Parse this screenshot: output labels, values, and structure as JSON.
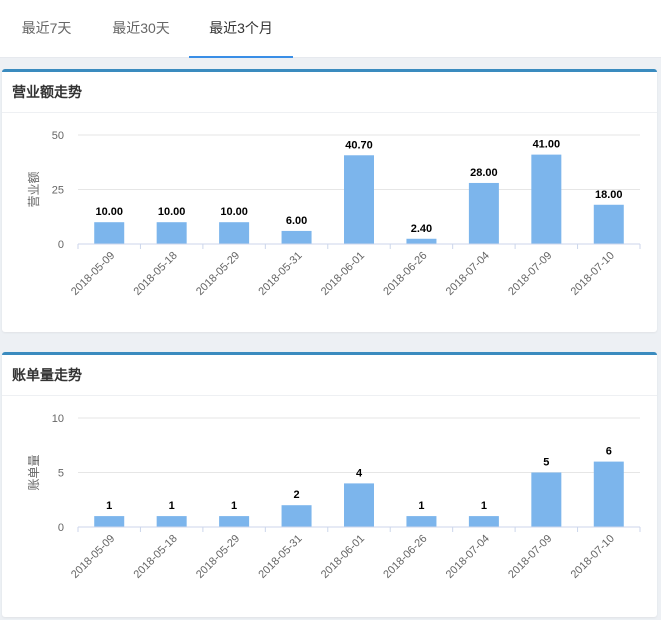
{
  "tabs": [
    {
      "label": "最近7天",
      "active": false
    },
    {
      "label": "最近30天",
      "active": false
    },
    {
      "label": "最近3个月",
      "active": true
    }
  ],
  "colors": {
    "bar": "#7cb5ec",
    "accent": "#3a8ee6",
    "card_border": "#3a8bbf",
    "gridline": "#e6e6e6",
    "axis_text": "#666666"
  },
  "charts": [
    {
      "title": "营业额走势",
      "chart_data": {
        "type": "bar",
        "categories": [
          "2018-05-09",
          "2018-05-18",
          "2018-05-29",
          "2018-05-31",
          "2018-06-01",
          "2018-06-26",
          "2018-07-04",
          "2018-07-09",
          "2018-07-10"
        ],
        "values": [
          10.0,
          10.0,
          10.0,
          6.0,
          40.7,
          2.4,
          28.0,
          41.0,
          18.0
        ],
        "value_labels": [
          "10.00",
          "10.00",
          "10.00",
          "6.00",
          "40.70",
          "2.40",
          "28.00",
          "41.00",
          "18.00"
        ],
        "ylabel": "营业额",
        "ylim": [
          0,
          50
        ],
        "yticks": [
          "0",
          "25",
          "50"
        ],
        "grid": true
      }
    },
    {
      "title": "账单量走势",
      "chart_data": {
        "type": "bar",
        "categories": [
          "2018-05-09",
          "2018-05-18",
          "2018-05-29",
          "2018-05-31",
          "2018-06-01",
          "2018-06-26",
          "2018-07-04",
          "2018-07-09",
          "2018-07-10"
        ],
        "values": [
          1,
          1,
          1,
          2,
          4,
          1,
          1,
          5,
          6
        ],
        "value_labels": [
          "1",
          "1",
          "1",
          "2",
          "4",
          "1",
          "1",
          "5",
          "6"
        ],
        "ylabel": "账单量",
        "ylim": [
          0,
          10
        ],
        "yticks": [
          "0",
          "5",
          "10"
        ],
        "grid": true
      }
    }
  ]
}
